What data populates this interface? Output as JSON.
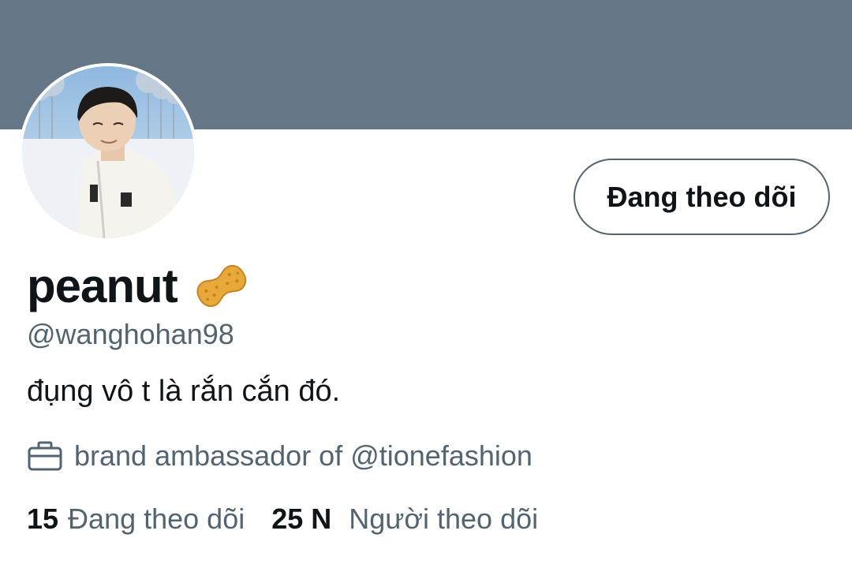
{
  "profile": {
    "display_name": "peanut",
    "name_emoji": "peanut-emoji",
    "handle": "@wanghohan98",
    "bio": "đụng vô t là rắn cắn đó.",
    "professional_category": "brand ambassador of @tionefashion",
    "professional_icon": "briefcase-icon"
  },
  "actions": {
    "follow_button_label": "Đang theo dõi"
  },
  "stats": {
    "following_count": "15",
    "following_label": "Đang theo dõi",
    "followers_count": "25 N",
    "followers_label": "Người theo dõi"
  },
  "colors": {
    "banner": "#657786",
    "secondary_text": "#536471",
    "primary_text": "#0f1419",
    "button_border": "#536471"
  }
}
